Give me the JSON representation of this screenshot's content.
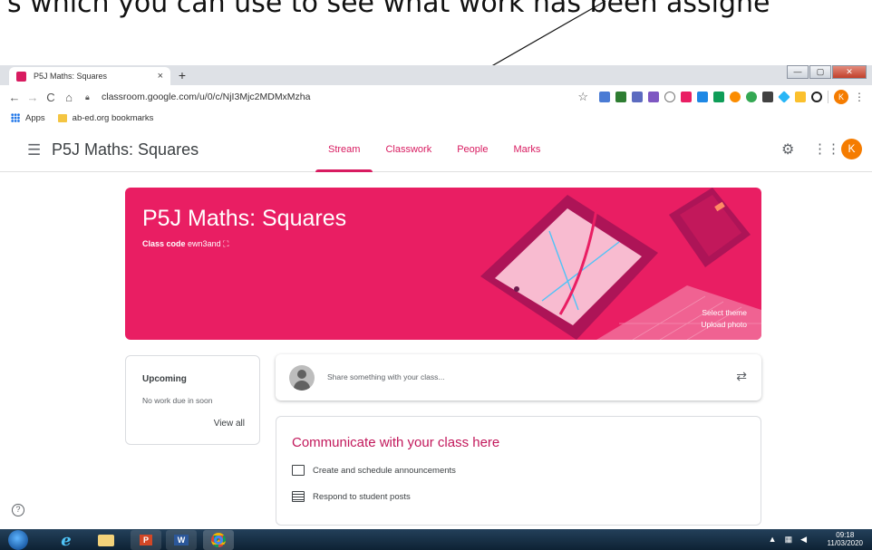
{
  "caption": "s which you can use to see what work has been assigne",
  "browser": {
    "tab_title": "P5J Maths: Squares",
    "tab_close": "×",
    "new_tab": "+",
    "url": "classroom.google.com/u/0/c/NjI3Mjc2MDMxMzha",
    "profile_initial": "K",
    "bookmarks": [
      {
        "label": "Apps"
      },
      {
        "label": "ab-ed.org bookmarks"
      }
    ],
    "window_controls": [
      "—",
      "▢",
      "✕"
    ]
  },
  "header": {
    "class_name": "P5J Maths: Squares",
    "tabs": [
      {
        "label": "Stream",
        "active": true
      },
      {
        "label": "Classwork"
      },
      {
        "label": "People"
      },
      {
        "label": "Marks"
      }
    ],
    "avatar_initial": "K"
  },
  "banner": {
    "title": "P5J Maths: Squares",
    "class_code_label": "Class code",
    "class_code": "ewn3and",
    "select_theme": "Select theme",
    "upload_photo": "Upload photo",
    "color": "#e91e63"
  },
  "upcoming": {
    "title": "Upcoming",
    "empty_text": "No work due in soon",
    "view_all": "View all"
  },
  "share": {
    "placeholder": "Share something with your class..."
  },
  "communicate": {
    "title": "Communicate with your class here",
    "items": [
      {
        "label": "Create and schedule announcements"
      },
      {
        "label": "Respond to student posts"
      }
    ]
  },
  "help_glyph": "?",
  "taskbar": {
    "time": "09:18",
    "date": "11/03/2020"
  },
  "accent_color": "#d81b60"
}
